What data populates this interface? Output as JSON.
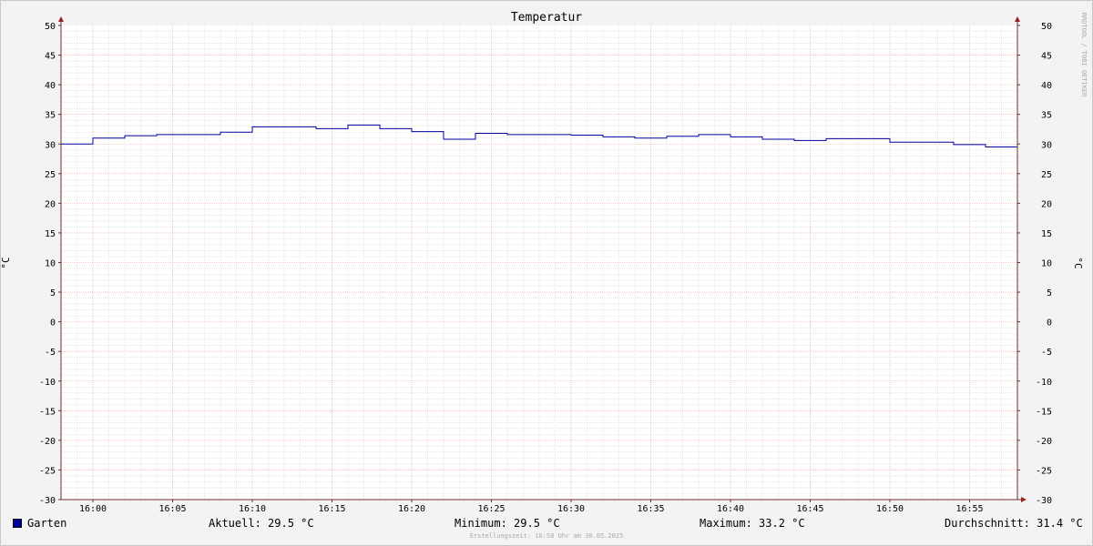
{
  "colors": {
    "background": "#f3f3f3",
    "plot_background": "#ffffff",
    "grid_minor": "#d8d8d8",
    "grid_major": "#f0a0a0",
    "axis": "#6a3030",
    "arrow": "#a02020",
    "series": "#0000a0"
  },
  "watermark": "RRDTOOL / TOBI OETIKER",
  "legend": {
    "series_name": "Garten",
    "current": "Aktuell: 29.5 °C",
    "minimum": "Minimum: 29.5 °C",
    "maximum": "Maximum: 33.2 °C",
    "average": "Durchschnitt: 31.4 °C"
  },
  "footer": "Erstellungszeit: 16:58 Uhr am 30.05.2025",
  "chart_data": {
    "type": "line",
    "title": "Temperatur",
    "ylabel": "°C",
    "ylabel_right": "°C",
    "ylim": [
      -30,
      50
    ],
    "yticks": [
      -30,
      -25,
      -20,
      -15,
      -10,
      -5,
      0,
      5,
      10,
      15,
      20,
      25,
      30,
      35,
      40,
      45,
      50
    ],
    "x_range": [
      "15:58",
      "16:58"
    ],
    "xticks": [
      "16:00",
      "16:05",
      "16:10",
      "16:15",
      "16:20",
      "16:25",
      "16:30",
      "16:35",
      "16:40",
      "16:45",
      "16:50",
      "16:55"
    ],
    "grid": true,
    "legend_position": "bottom",
    "series": [
      {
        "name": "Garten",
        "step": true,
        "x": [
          "15:58",
          "16:00",
          "16:02",
          "16:04",
          "16:08",
          "16:10",
          "16:14",
          "16:16",
          "16:18",
          "16:20",
          "16:22",
          "16:24",
          "16:26",
          "16:30",
          "16:32",
          "16:34",
          "16:36",
          "16:38",
          "16:40",
          "16:42",
          "16:44",
          "16:46",
          "16:50",
          "16:54",
          "16:56",
          "16:58"
        ],
        "values": [
          30.0,
          31.0,
          31.4,
          31.6,
          32.0,
          32.9,
          32.6,
          33.2,
          32.6,
          32.1,
          30.8,
          31.8,
          31.6,
          31.5,
          31.2,
          31.0,
          31.3,
          31.6,
          31.2,
          30.8,
          30.6,
          30.9,
          30.3,
          29.9,
          29.5,
          29.5
        ]
      }
    ]
  }
}
